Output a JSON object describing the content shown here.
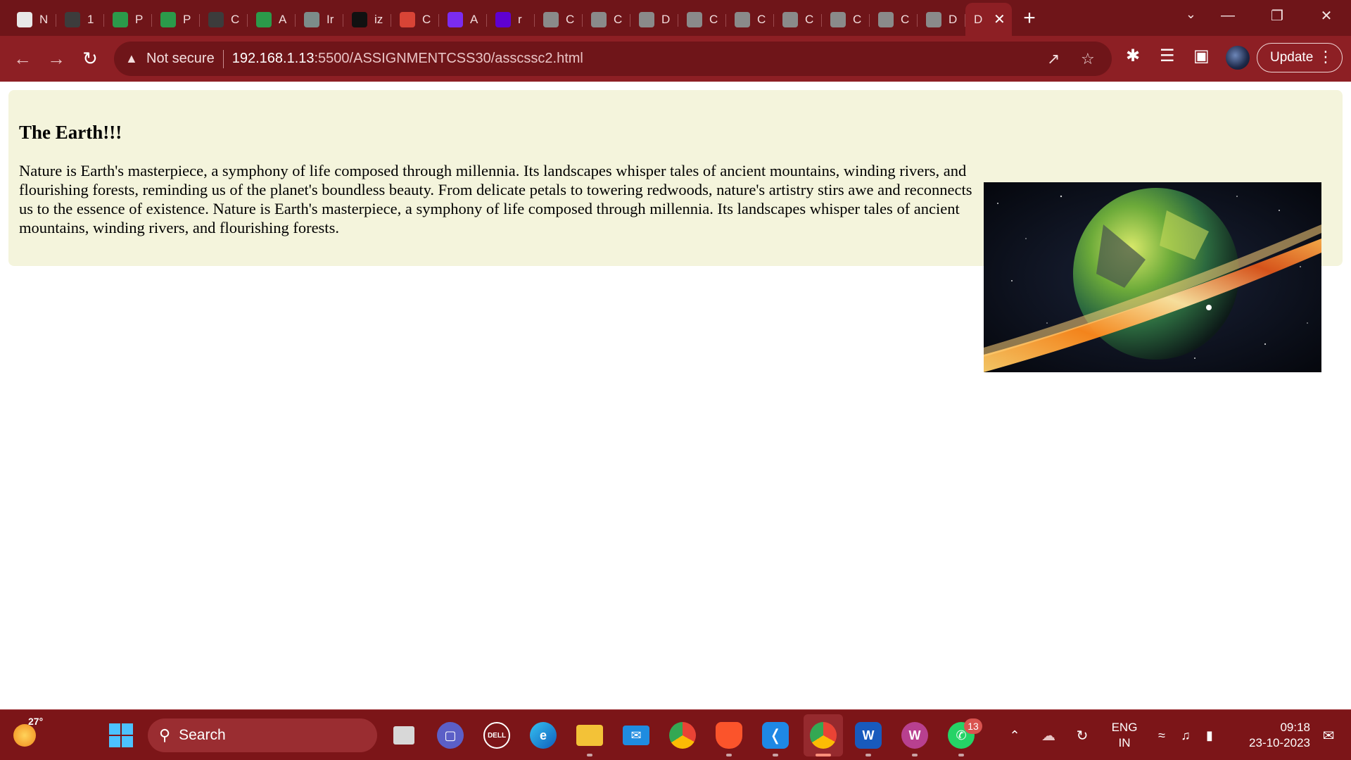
{
  "browser": {
    "tabs": [
      {
        "initial": "N",
        "icon": "newspaper-icon",
        "color": "#e8e8e8"
      },
      {
        "initial": "1",
        "icon": "wordpress-icon",
        "color": "#3c3c3c"
      },
      {
        "initial": "P",
        "icon": "google-drive-icon",
        "color": "#2b9a4a"
      },
      {
        "initial": "P",
        "icon": "google-drive-icon",
        "color": "#2b9a4a"
      },
      {
        "initial": "C",
        "icon": "wordpress-icon",
        "color": "#3c3c3c"
      },
      {
        "initial": "A",
        "icon": "google-drive-icon",
        "color": "#2b9a4a"
      },
      {
        "initial": "Ir",
        "icon": "chatgpt-icon",
        "color": "#7c8c8a"
      },
      {
        "initial": "iz",
        "icon": "github-icon",
        "color": "#111111"
      },
      {
        "initial": "C",
        "icon": "gmail-icon",
        "color": "#d94436"
      },
      {
        "initial": "A",
        "icon": "arrow-app-icon",
        "color": "#7b2cf0"
      },
      {
        "initial": "r",
        "icon": "yahoo-icon",
        "color": "#5f01d1"
      },
      {
        "initial": "C",
        "icon": "globe-icon",
        "color": "#8a8a8a"
      },
      {
        "initial": "C",
        "icon": "globe-icon",
        "color": "#8a8a8a"
      },
      {
        "initial": "D",
        "icon": "globe-icon",
        "color": "#8a8a8a"
      },
      {
        "initial": "C",
        "icon": "globe-icon",
        "color": "#8a8a8a"
      },
      {
        "initial": "C",
        "icon": "globe-icon",
        "color": "#8a8a8a"
      },
      {
        "initial": "C",
        "icon": "globe-icon",
        "color": "#8a8a8a"
      },
      {
        "initial": "C",
        "icon": "globe-icon",
        "color": "#8a8a8a"
      },
      {
        "initial": "C",
        "icon": "globe-icon",
        "color": "#8a8a8a"
      },
      {
        "initial": "D",
        "icon": "globe-icon",
        "color": "#8a8a8a"
      }
    ],
    "active_tab_initial": "D",
    "not_secure_label": "Not secure",
    "url_host": "192.168.1.13",
    "url_path": ":5500/ASSIGNMENTCSS30/asscssc2.html",
    "update_label": "Update"
  },
  "page": {
    "title": "The Earth!!!",
    "body": "Nature is Earth's masterpiece, a symphony of life composed through millennia. Its landscapes whisper tales of ancient mountains, winding rivers, and flourishing forests, reminding us of the planet's boundless beauty. From delicate petals to towering redwoods, nature's artistry stirs awe and reconnects us to the essence of existence. Nature is Earth's masterpiece, a symphony of life composed through millennia. Its landscapes whisper tales of ancient mountains, winding rivers, and flourishing forests.",
    "card_bg": "#f4f4dc"
  },
  "taskbar": {
    "weather_temp": "27°",
    "search_label": "Search",
    "whatsapp_badge": "13",
    "lang_top": "ENG",
    "lang_bottom": "IN",
    "time": "09:18",
    "date": "23-10-2023"
  },
  "colors": {
    "tabstrip": "#6f1519",
    "toolbar": "#8d1f24",
    "taskbar": "#7c1518"
  }
}
